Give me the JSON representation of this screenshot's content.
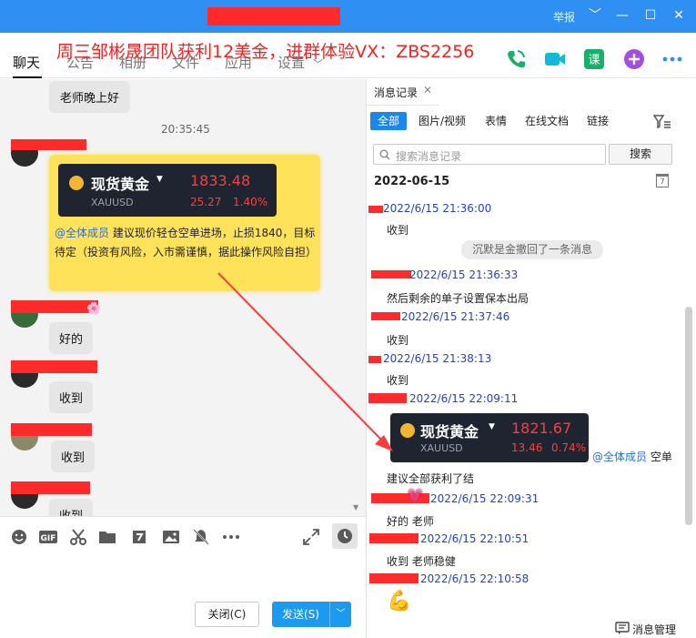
{
  "window": {
    "report": "举报",
    "controls": [
      "﹀",
      "—",
      "☐",
      "✕"
    ]
  },
  "overlay_title": "周三邹彬晟团队获利12美金，进群体验VX：ZBS2256",
  "nav": {
    "tabs": [
      "聊天",
      "公告",
      "相册",
      "文件",
      "应用",
      "设置"
    ]
  },
  "chat": {
    "greeting": "老师晚上好",
    "time": "20:35:45",
    "card": {
      "name": "现货黄金",
      "symbol": "XAUUSD",
      "price": "1833.48",
      "change": "25.27",
      "change_pct": "1.40%"
    },
    "card_mention": "@全体成员",
    "card_text": " 建议现价轻仓空单进场，止损1840，目标待定（投资有风险，入市需谨慎，据此操作风险自担）",
    "replies": [
      "好的",
      "收到",
      "收到",
      "收到"
    ]
  },
  "input": {
    "close_label": "关闭(C)",
    "send_label": "发送(S)"
  },
  "history": {
    "tab_label": "消息记录",
    "filters": [
      "全部",
      "图片/视频",
      "表情",
      "在线文档",
      "链接"
    ],
    "search_placeholder": "搜索消息记录",
    "search_button": "搜索",
    "date": "2022-06-15",
    "calendar_day": "7",
    "recall_text": "沉默是金撤回了一条消息",
    "entries": [
      {
        "time": "2022/6/15 21:36:00",
        "text": "收到"
      },
      {
        "time": "2022/6/15 21:36:33",
        "text": "然后剩余的单子设置保本出局"
      },
      {
        "time": "2022/6/15 21:37:46",
        "text": "收到"
      },
      {
        "time": "2022/6/15 21:38:13",
        "text": "收到"
      },
      {
        "time": "2022/6/15 22:09:11",
        "text": ""
      },
      {
        "time": "2022/6/15 22:09:31",
        "text": "好的  老师"
      },
      {
        "time": "2022/6/15 22:10:51",
        "text": "收到 老师稳健"
      },
      {
        "time": "2022/6/15 22:10:58",
        "text": ""
      }
    ],
    "card": {
      "name": "现货黄金",
      "symbol": "XAUUSD",
      "price": "1821.67",
      "change": "13.46",
      "change_pct": "0.74%"
    },
    "card_mention": "@全体成员",
    "card_mention_tail": " 空单",
    "followup": "建议全部获利了结",
    "manage_label": "消息管理"
  }
}
